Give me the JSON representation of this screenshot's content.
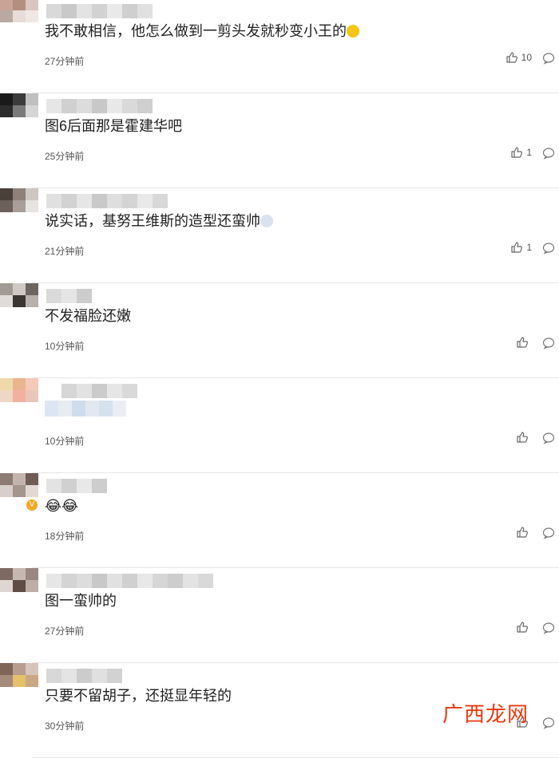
{
  "comments": [
    {
      "text": "我不敢相信，他怎么做到一剪头发就秒变小王的",
      "emoji": "🙈",
      "time": "27分钟前",
      "likes": "10",
      "avatar": [
        "#c9a396",
        "#b38f82",
        "#d9c6c0",
        "#b9a9a2",
        "#e8dcd8",
        "#efe7e4"
      ],
      "name": [
        "#d9d9d9",
        "#c9c9c9",
        "#e3e3e3",
        "#d2d2d2",
        "#e9e9e9",
        "#cfcfcf",
        "#e0e0e0"
      ]
    },
    {
      "text": "图6后面那是霍建华吧",
      "time": "25分钟前",
      "likes": "1",
      "avatar": [
        "#1a1a1a",
        "#3b3b3b",
        "#bfbfbf",
        "#2c2c2c",
        "#7a7a7a",
        "#d5d5d5"
      ],
      "name": [
        "#e6e6e6",
        "#d0d0d0",
        "#dcdcdc",
        "#c8c8c8",
        "#e8e8e8",
        "#d9d9d9",
        "#cfcfcf"
      ]
    },
    {
      "text": "说实话，基努王维斯的造型还蛮帅",
      "emoji": "😬",
      "time": "21分钟前",
      "likes": "1",
      "avatar": [
        "#4a4039",
        "#8f8179",
        "#cdc6c1",
        "#6d625b",
        "#a89f99",
        "#e7e3e0"
      ],
      "name": [
        "#e0e0e0",
        "#d2d2d2",
        "#e6e6e6",
        "#c9c9c9",
        "#dedede",
        "#d4d4d4",
        "#e9e9e9",
        "#d8d8d8"
      ]
    },
    {
      "text": "不发福脸还嫩",
      "time": "10分钟前",
      "likes": "",
      "avatar": [
        "#a49a94",
        "#cfc8c3",
        "#6c6560",
        "#e0dcd9",
        "#3a3633",
        "#b7b0ab"
      ],
      "name": [
        "#dadada",
        "#e5e5e5",
        "#cccccc"
      ]
    },
    {
      "text": "",
      "time": "10分钟前",
      "likes": "",
      "avatar": [
        "#f0d9a8",
        "#e9b590",
        "#f5c9b7",
        "#efd7c5",
        "#f3b0a0",
        "#e8c7b8"
      ],
      "name": [
        "#ffffff",
        "#d6d6d6",
        "#e2e2e2",
        "#cbcbcb",
        "#e6e6e6",
        "#d9d9d9"
      ]
    },
    {
      "text": "😂😂",
      "time": "18分钟前",
      "likes": "",
      "avatar": [
        "#8c7b73",
        "#c3b4ad",
        "#6f5c54",
        "#d9cfca",
        "#a6958d",
        "#e2d9d4"
      ],
      "name": [
        "#e3e3e3",
        "#d0d0d0",
        "#e8e8e8",
        "#cdcdcd"
      ]
    },
    {
      "text": "图一蛮帅的",
      "time": "27分钟前",
      "likes": "",
      "avatar": [
        "#7d6a62",
        "#c7b9b2",
        "#9a8780",
        "#e0d6d1",
        "#5e4c45",
        "#bcaea7"
      ],
      "name": [
        "#e6e6e6",
        "#d4d4d4",
        "#dddddd",
        "#c8c8c8",
        "#e1e1e1",
        "#d0d0d0",
        "#e8e8e8",
        "#d6d6d6",
        "#cdcdcd",
        "#e3e3e3",
        "#d9d9d9"
      ]
    },
    {
      "text": "只要不留胡子，还挺显年轻的",
      "time": "30分钟前",
      "likes": "",
      "avatar": [
        "#7e6558",
        "#b89c8e",
        "#d7c4b9",
        "#a68a7c",
        "#e4c16a",
        "#caa884"
      ],
      "name": [
        "#d8d8d8",
        "#e4e4e4",
        "#cccccc",
        "#e0e0e0",
        "#d2d2d2"
      ]
    }
  ],
  "watermark": "广西龙网"
}
